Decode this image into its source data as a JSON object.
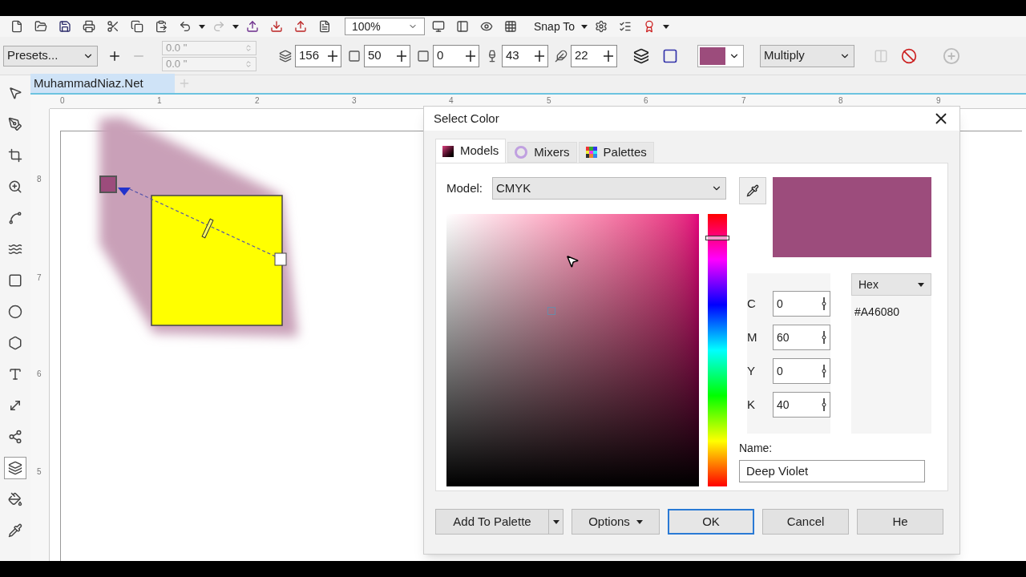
{
  "toolbar": {
    "zoom": "100%",
    "snap": "Snap To"
  },
  "property_bar": {
    "preset": "Presets...",
    "offsets": [
      {
        "value": "0.0 \"",
        "disabled": true
      },
      {
        "value": "0.0 \"",
        "disabled": true
      }
    ],
    "fields": [
      {
        "value": "156"
      },
      {
        "value": "50"
      },
      {
        "value": "0"
      },
      {
        "value": "43"
      },
      {
        "value": "22"
      }
    ],
    "shadow_color": {
      "color": "#9c4c7c"
    },
    "merge_mode": "Multiply"
  },
  "toolbox": [
    {
      "selected": false
    },
    {
      "selected": false
    },
    {
      "selected": false
    },
    {
      "selected": false
    },
    {
      "selected": false
    },
    {
      "selected": false
    },
    {
      "selected": false
    },
    {
      "selected": false
    },
    {
      "selected": false
    },
    {
      "selected": false
    },
    {
      "selected": false
    },
    {
      "selected": false
    },
    {
      "selected": true
    },
    {
      "selected": false
    },
    {
      "selected": false
    }
  ],
  "document_tab": {
    "title": "MuhammadNiaz.Net",
    "selected": true
  },
  "rulers": {
    "horizontal": [
      "0",
      "1",
      "2",
      "3",
      "4",
      "5",
      "6",
      "7",
      "8",
      "9"
    ],
    "vertical": [
      "8",
      "7",
      "6",
      "5"
    ]
  },
  "dialog": {
    "title": "Select Color",
    "tabs": [
      {
        "label": "Models",
        "selected": true
      },
      {
        "label": "Mixers",
        "selected": false
      },
      {
        "label": "Palettes",
        "selected": false
      }
    ],
    "model_label": "Model:",
    "model": "CMYK",
    "preview": {
      "color": "#9c4c7c"
    },
    "hue": {
      "level": 0.92
    },
    "format": "Hex",
    "hex": "#A46080",
    "components": [
      {
        "label": "C",
        "value": "0"
      },
      {
        "label": "M",
        "value": "60"
      },
      {
        "label": "Y",
        "value": "0"
      },
      {
        "label": "K",
        "value": "40"
      }
    ],
    "name_label": "Name:",
    "name": "Deep Violet",
    "buttons": [
      {
        "label": "Add To Palette",
        "kind": "split"
      },
      {
        "label": "Options",
        "kind": "menu"
      },
      {
        "label": "OK",
        "kind": "default"
      },
      {
        "label": "Cancel",
        "kind": "plain"
      },
      {
        "label": "He",
        "kind": "plain"
      }
    ]
  }
}
